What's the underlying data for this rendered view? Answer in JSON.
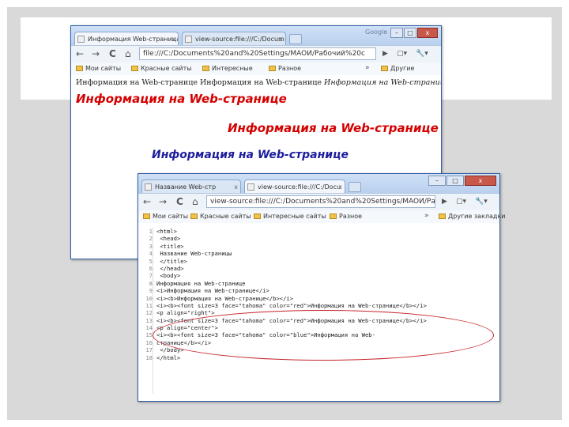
{
  "window1": {
    "tabs": [
      {
        "title": "Информация Web-страница"
      },
      {
        "title": "view-source:file:///C:/Docum"
      }
    ],
    "brand": "Google",
    "controls": [
      "–",
      "□",
      "x"
    ],
    "nav": {
      "back": "←",
      "forward": "→",
      "reload": "C",
      "home": "⌂",
      "go": "▶",
      "page": "▢▾",
      "wrench": "🔧▾"
    },
    "address": "file:///C:/Documents%20and%20Settings/MAOИ/Рабочий%20с",
    "bookmarks": [
      "Мои сайты",
      "Красные сайты",
      "Интересные",
      "Разное"
    ],
    "more": "»",
    "other": "Другие",
    "content": {
      "line_plain": "Информация на Web-странице ",
      "line_plain2": "Информация на Web-странице ",
      "line_italic": "Информация на Web-странице",
      "heading_left": "Информация на Web-странице",
      "heading_right": "Информация на Web-странице",
      "heading_center": "Информация на Web-странице"
    }
  },
  "window2": {
    "tabs": [
      {
        "title": "Название Web-стр"
      },
      {
        "title": "view-source:file:///C:/Docu"
      }
    ],
    "controls": [
      "–",
      "□",
      "x"
    ],
    "nav": {
      "back": "←",
      "forward": "→",
      "reload": "C",
      "home": "⌂",
      "go": "▶",
      "page": "▢▾",
      "wrench": "🔧▾"
    },
    "address": "view-source:file:///C:/Documents%20and%20Settings/MAOИ/Рабо",
    "bookmarks": [
      "Мои сайты",
      "Красные сайты",
      "Интересные сайты",
      "Разное"
    ],
    "more": "»",
    "other": "Другие закладки",
    "source_lines": [
      "<html>",
      " <head>",
      " <title>",
      " Название Web-страницы",
      " </title>",
      " </head>",
      " <body>",
      "Информация на Web-странице",
      "<i>Информация на Web-странице</i>",
      "<i><b>Информация на Web-странице</b></i>",
      "<i><b><font size=3 face=\"tahoma\" color=\"red\">Информация на Web-странице</b></i>",
      "<p align=\"right\">",
      "<i><b><font size=3 face=\"tahoma\" color=\"red\">Информация на Web-странице</b></i>",
      "<p align=\"center\">",
      "<i><b><font size=3 face=\"tahoma\" color=\"blue\">Информация на Web-",
      "странице</b></i>",
      " </body>",
      "</html>"
    ],
    "line_numbers": [
      "1",
      "2",
      "3",
      "4",
      "5",
      "6",
      "7",
      "8",
      "9",
      "10",
      "11",
      "12",
      "13",
      "14",
      "15",
      "16",
      "17",
      "18"
    ]
  },
  "colors": {
    "heading_red": "#d50000",
    "heading_blue": "#1d1d9c",
    "annotation": "#c4242b"
  }
}
